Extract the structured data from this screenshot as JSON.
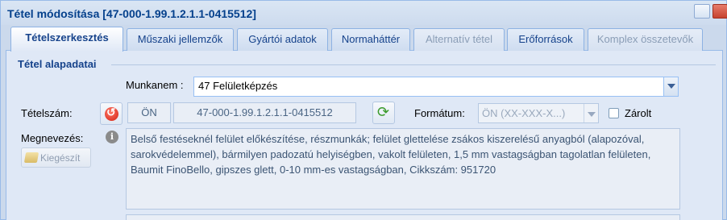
{
  "window": {
    "title": "Tétel módosítása [47-000-1.99.1.2.1.1-0415512]"
  },
  "tabs": [
    {
      "label": "Tételszerkesztés",
      "state": "active"
    },
    {
      "label": "Műszaki jellemzők",
      "state": "normal"
    },
    {
      "label": "Gyártói adatok",
      "state": "normal"
    },
    {
      "label": "Normaháttér",
      "state": "normal"
    },
    {
      "label": "Alternatív tétel",
      "state": "disabled"
    },
    {
      "label": "Erőforrások",
      "state": "normal"
    },
    {
      "label": "Komplex összetevők",
      "state": "disabled"
    }
  ],
  "section": {
    "legend": "Tétel alapadatai"
  },
  "munkanem": {
    "label": "Munkanem :",
    "value": "47 Felületképzés"
  },
  "tetelszam": {
    "label": "Tételszám:",
    "prefix": "ÖN",
    "number": "47-000-1.99.1.2.1.1-0415512"
  },
  "formatum": {
    "label": "Formátum:",
    "value": "ÖN (XX-XXX-X...)"
  },
  "zarolt": {
    "label": "Zárolt",
    "checked": false
  },
  "megnevezes": {
    "label": "Megnevezés:",
    "kiegeszit_label": "Kiegészít",
    "text": "Belső festéseknél felület előkészítése, részmunkák; felület glettelése zsákos kiszerelésű anyagból (alapozóval, sarokvédelemmel), bármilyen padozatú helyiségben, vakolt felületen, 1,5 mm vastagságban tagolatlan felületen, Baumit FinoBello, gipszes glett, 0-10 mm-es vastagságban, Cikkszám: 951720"
  }
}
